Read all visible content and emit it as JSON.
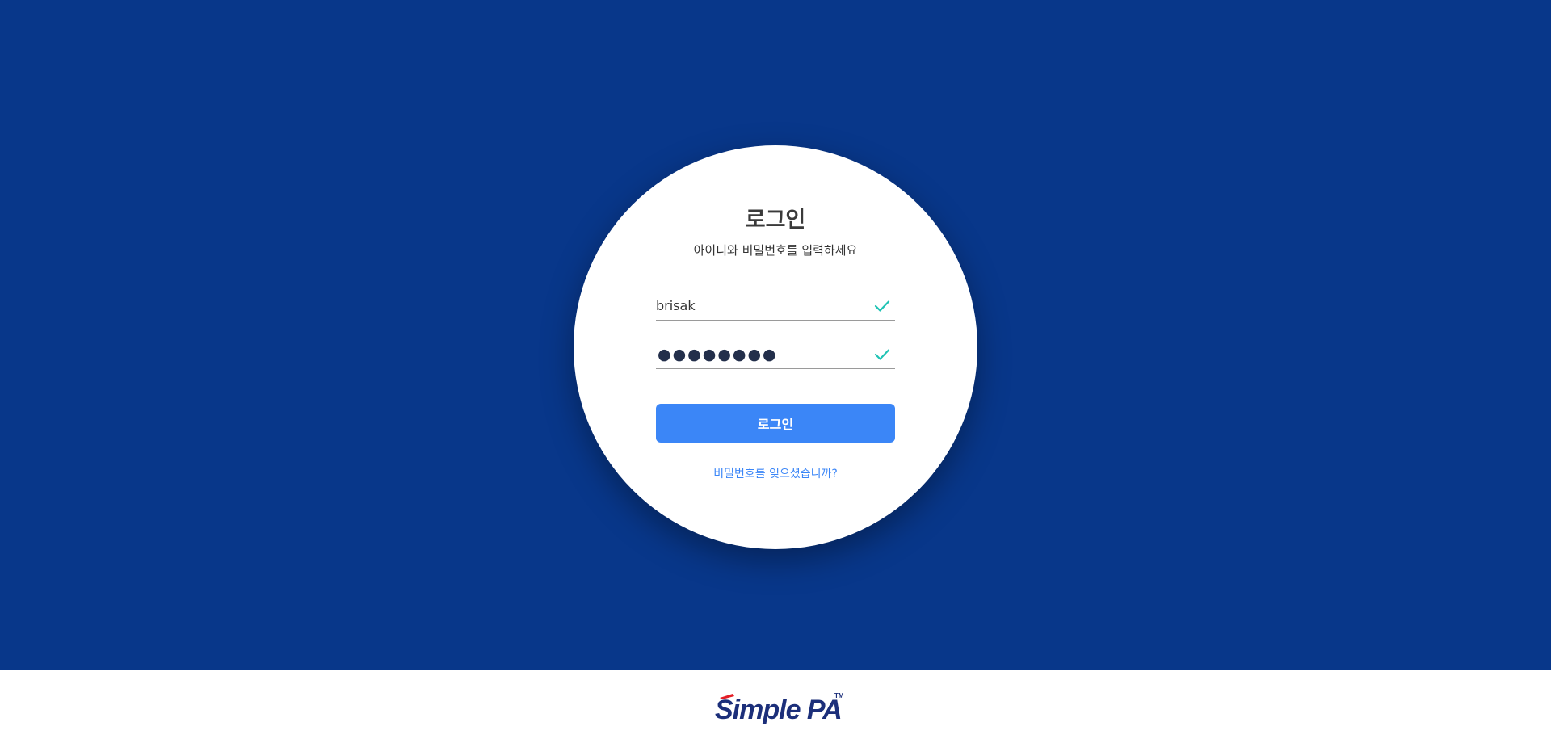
{
  "login": {
    "title": "로그인",
    "subtitle": "아이디와 비밀번호를 입력하세요",
    "username_value": "brisak",
    "password_mask": "●●●●●●●●",
    "button_label": "로그인",
    "forgot_link": "비밀번호를 잊으셨습니까?"
  },
  "icons": {
    "username_valid": "check-icon",
    "password_valid": "check-icon"
  },
  "footer": {
    "logo_text": "Simple PA",
    "logo_tm": "™"
  },
  "colors": {
    "background": "#08378a",
    "primary": "#3b86f7",
    "check": "#1fc3b4",
    "logo_navy": "#1c2f7a",
    "logo_red": "#e41e26"
  }
}
